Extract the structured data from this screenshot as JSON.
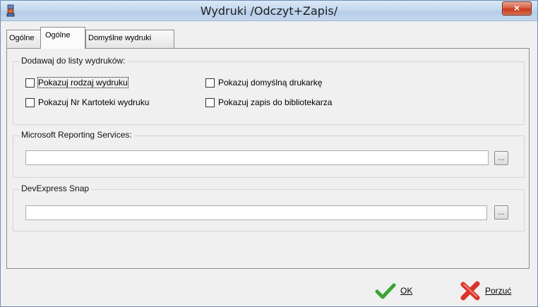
{
  "window": {
    "title": "Wydruki /Odczyt+Zapis/",
    "close_glyph": "×"
  },
  "tabs": [
    {
      "label": "Ogólne",
      "active": false
    },
    {
      "label": "Ogólne",
      "active": true
    },
    {
      "label": "Domyślne wydruki",
      "active": false
    }
  ],
  "group_print_list": {
    "title": "Dodawaj do listy wydruków:",
    "checkboxes": [
      {
        "label": "Pokazuj rodzaj wydruku",
        "checked": false
      },
      {
        "label": "Pokazuj Nr Kartoteki wydruku",
        "checked": false
      },
      {
        "label": "Pokazuj domyślną drukarkę",
        "checked": false
      },
      {
        "label": "Pokazuj zapis do bibliotekarza",
        "checked": false
      }
    ]
  },
  "group_ms_reporting": {
    "title": "Microsoft Reporting Services:",
    "value": "",
    "browse_label": "..."
  },
  "group_devexpress": {
    "title": "DevExpress Snap",
    "value": "",
    "browse_label": "..."
  },
  "buttons": {
    "ok_label": "OK",
    "cancel_label": "Porzuć"
  },
  "colors": {
    "ok_icon": "#3aa334",
    "cancel_icon": "#d9342b",
    "close_button": "#c7381b"
  }
}
